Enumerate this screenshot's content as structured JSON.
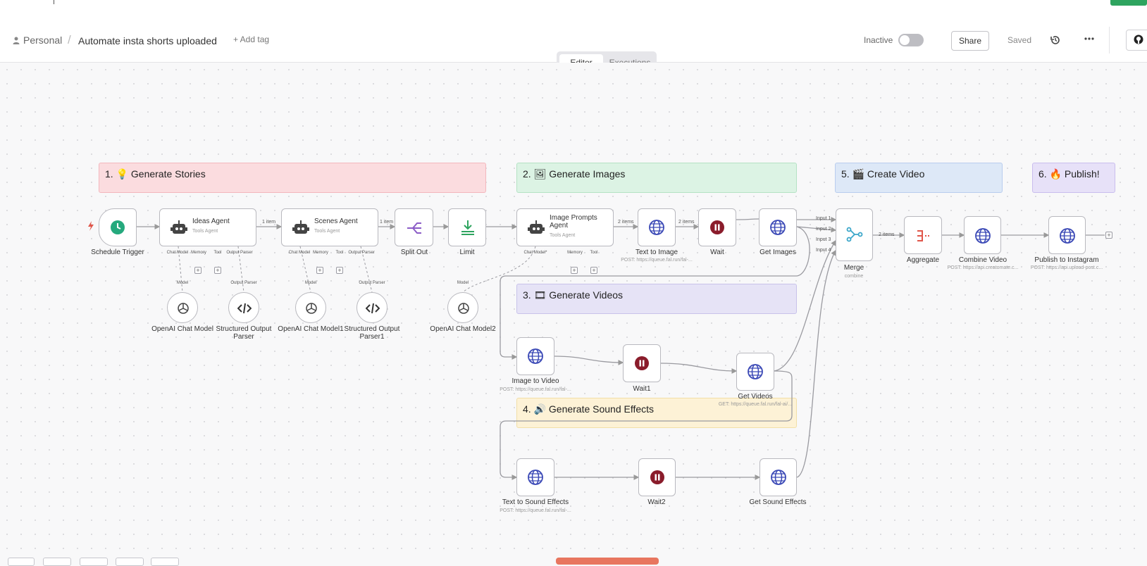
{
  "header": {
    "personal": "Personal",
    "separator": "/",
    "workflow_title": "Automate insta shorts uploaded",
    "add_tag": "+ Add tag",
    "status_label": "Inactive",
    "share": "Share",
    "saved": "Saved"
  },
  "tabs": {
    "editor": "Editor",
    "executions": "Executions"
  },
  "stickies": {
    "s1": "1. 💡 Generate Stories",
    "s2": "2. 🖼 Generate Images",
    "s3": "3. 🎞 Generate Videos",
    "s4": "4. 🔊 Generate Sound Effects",
    "s5": "5. 🎬 Create Video",
    "s6": "6. 🔥 Publish!"
  },
  "nodes": {
    "schedule": {
      "label": "Schedule Trigger"
    },
    "ideas": {
      "label": "Ideas Agent",
      "sub": "Tools Agent"
    },
    "scenes": {
      "label": "Scenes Agent",
      "sub": "Tools Agent"
    },
    "split": {
      "label": "Split Out"
    },
    "limit": {
      "label": "Limit"
    },
    "prompts": {
      "label": "Image Prompts Agent",
      "sub": "Tools Agent"
    },
    "t2i": {
      "label": "Text to Image",
      "sub": "POST: https://queue.fal.run/fal-..."
    },
    "wait": {
      "label": "Wait"
    },
    "getimg": {
      "label": "Get Images"
    },
    "merge": {
      "label": "Merge",
      "sub": "combine"
    },
    "aggregate": {
      "label": "Aggregate"
    },
    "combine": {
      "label": "Combine Video",
      "sub": "POST: https://api.creatomate.c..."
    },
    "publish": {
      "label": "Publish to Instagram",
      "sub": "POST: https://api.upload-post.c..."
    },
    "i2v": {
      "label": "Image to Video",
      "sub": "POST: https://queue.fal.run/fal-..."
    },
    "wait1": {
      "label": "Wait1"
    },
    "getvid": {
      "label": "Get Videos",
      "sub": "GET: https://queue.fal.run/fal-ai/..."
    },
    "t2s": {
      "label": "Text to Sound Effects",
      "sub": "POST: https://queue.fal.run/fal-..."
    },
    "wait2": {
      "label": "Wait2"
    },
    "getsfx": {
      "label": "Get Sound Effects"
    },
    "oai": {
      "label": "OpenAI Chat Model"
    },
    "oai1": {
      "label": "OpenAI Chat Model1"
    },
    "oai2": {
      "label": "OpenAI Chat Model2"
    },
    "sop": {
      "label": "Structured Output Parser"
    },
    "sop1": {
      "label": "Structured Output Parser1"
    }
  },
  "connectors": {
    "chat_model": "Chat Model",
    "chat_model_req": "Chat Model*",
    "memory": "Memory",
    "tool": "Tool",
    "output_parser": "Output Parser",
    "model": "Model",
    "plus": "+"
  },
  "edge_labels": {
    "one_item": "1 item",
    "two_items": "2 items",
    "input1": "Input 1",
    "input2": "Input 2",
    "input3": "Input 3",
    "input4": "Input 4"
  },
  "icons": {
    "clock": "clock-icon",
    "robot": "robot-icon",
    "globe": "globe-icon",
    "pause": "pause-icon",
    "merge": "merge-icon",
    "split": "split-icon",
    "limit": "limit-icon",
    "aggregate": "aggregate-icon",
    "openai": "openai-icon",
    "code": "code-icon"
  },
  "colors": {
    "sticky_red": "#fbdcdf",
    "sticky_green": "#dcf3e4",
    "sticky_purple": "#e6e3f6",
    "sticky_yellow": "#fdf2d6",
    "sticky_blue": "#dde8f7",
    "sticky_violet": "#e7e1f8",
    "trigger_green": "#25a97d",
    "globe_blue": "#3b49b6",
    "wait_red": "#8a1c2b",
    "connector": "#7a7ad0"
  }
}
